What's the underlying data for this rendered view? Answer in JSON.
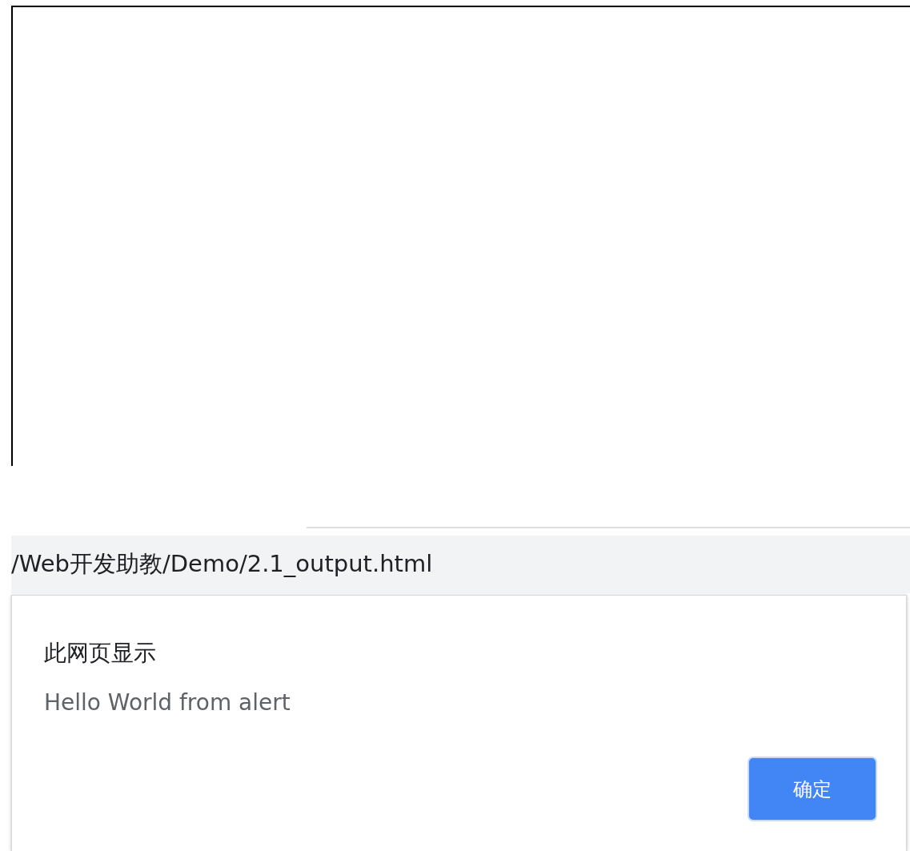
{
  "address_bar": {
    "url": "/Web开发助教/Demo/2.1_output.html"
  },
  "dialog": {
    "title": "此网页显示",
    "message": "Hello World from alert",
    "buttons": [
      "确定"
    ]
  }
}
